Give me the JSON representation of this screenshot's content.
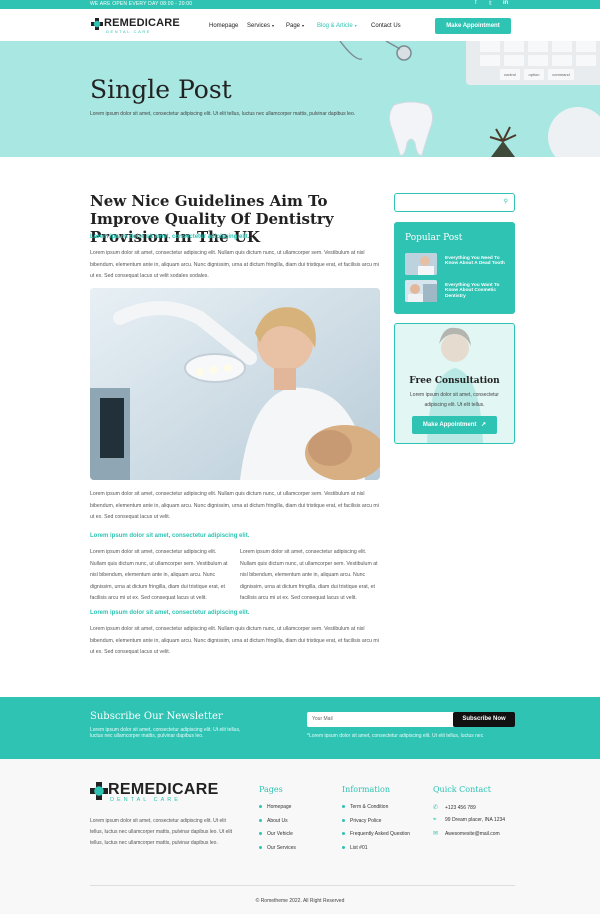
{
  "topbar": {
    "hours": "WE ARE OPEN EVERY DAY  08:00 - 20:00",
    "social_facebook": "f",
    "social_twitter": "𝕥",
    "social_linkedin": "in"
  },
  "brand": {
    "name": "REMEDICARE",
    "tagline": "DENTAL CARE",
    "accent": "#2fc3b3"
  },
  "nav": {
    "items": [
      {
        "label": "Homepage"
      },
      {
        "label": "Services"
      },
      {
        "label": "Page"
      },
      {
        "label": "Blog & Article"
      },
      {
        "label": "Contact Us"
      }
    ],
    "cta": "Make Appointment"
  },
  "hero": {
    "title": "Single Post",
    "subtitle": "Lorem ipsum dolor sit amet, consectetur adipiscing elit. Ut elit tellus, luctus nec ullamcorper mattis, pulvinar dapibus leo.",
    "keys": [
      "control",
      "option",
      "command"
    ]
  },
  "article": {
    "title": "New Nice Guidelines Aim To Improve Quality Of Dentistry Provision In The UK",
    "lead": "Lorem ipsum dolor sit amet, consectetur adipiscing elit.",
    "p1": "Lorem ipsum dolor sit amet, consectetur adipiscing elit. Nullam quis dictum nunc, ut ullamcorper sem. Vestibulum at nisl bibendum, elementum ante in, aliquam arcu. Nunc dignissim, urna at dictum fringilla, diam dui tristique erat, et facilisis arcu mi ut ex. Sed consequat lacus ut velit sodales sodales.",
    "p2": "Lorem ipsum dolor sit amet, consectetur adipiscing elit. Nullam quis dictum nunc, ut ullamcorper sem. Vestibulum at nisl bibendum, elementum ante in, aliquam arcu. Nunc dignissim, urna at dictum fringilla, diam dui tristique erat, et facilisis arcu mi ut ex. Sed consequat lacus ut velit.",
    "h2": "Lorem ipsum dolor sit amet, consectetur adipiscing elit.",
    "col1": "Lorem ipsum dolor sit amet, consectetur adipiscing elit. Nullam quis dictum nunc, ut ullamcorper sem. Vestibulum at nisl bibendum, elementum ante in, aliquam arcu. Nunc dignissim, urna at dictum fringilla, diam dui tristique erat, et facilisis arcu mi ut ex. Sed consequat lacus ut velit.",
    "col2": "Lorem ipsum dolor sit amet, consectetur adipiscing elit. Nullam quis dictum nunc, ut ullamcorper sem. Vestibulum at nisl bibendum, elementum ante in, aliquam arcu. Nunc dignissim, urna at dictum fringilla, diam dui tristique erat, et facilisis arcu mi ut ex. Sed consequat lacus ut velit.",
    "h3": "Lorem ipsum dolor sit amet, consectetur adipiscing elit.",
    "p3": "Lorem ipsum dolor sit amet, consectetur adipiscing elit. Nullam quis dictum nunc, ut ullamcorper sem. Vestibulum at nisl bibendum, elementum ante in, aliquam arcu. Nunc dignissim, urna at dictum fringilla, diam dui tristique erat, et facilisis arcu mi ut ex. Sed consequat lacus ut velit."
  },
  "sidebar": {
    "search_placeholder": "",
    "popular_title": "Popular Post",
    "posts": [
      {
        "title": "Everything You Need To Know About A Dead Tooth"
      },
      {
        "title": "Everything You Want To Know About Cosmetic Dentistry"
      }
    ],
    "consult_title": "Free Consultation",
    "consult_text": "Lorem ipsum dolor sit amet, consectetur adipiscing elit. Ut elit tellus.",
    "consult_button": "Make Appointment"
  },
  "newsletter": {
    "title": "Subscribe Our Newsletter",
    "text": "Lorem ipsum dolor sit amet, consectetur adipiscing elit. Ut elit tellus, luctus nec ullamcorper mattis, pulvinar dapibus leo.",
    "placeholder": "Your Mail",
    "button": "Subscribe Now",
    "note": "*Lorem ipsum dolor sit amet, consectetur adipiscing elit. Ut elit tellus, luctus nec"
  },
  "footer": {
    "desc": "Lorem ipsum dolor sit amet, consectetur adipiscing elit. Ut elit tellus, luctus nec ullamcorper mattis, pulvinar dapibus leo. Ut elit tellus, luctus nec ullamcorper mattis, pulvinar dapibus leo.",
    "pages_title": "Pages",
    "pages": [
      "Homepage",
      "About Us",
      "Our Vehicle",
      "Our Services"
    ],
    "info_title": "Information",
    "info": [
      "Term & Condition",
      "Privacy Police",
      "Frequently Asked Question",
      "List #01"
    ],
    "contact_title": "Quick Contact",
    "contact": [
      {
        "icon": "phone-icon",
        "text": "+123 456 789"
      },
      {
        "icon": "location-icon",
        "text": "99 Dream placer, INA 1234"
      },
      {
        "icon": "mail-icon",
        "text": "Awesomesite@mail.com"
      }
    ],
    "copyright": "©  Rometheme 2022. All Right Reserved"
  }
}
